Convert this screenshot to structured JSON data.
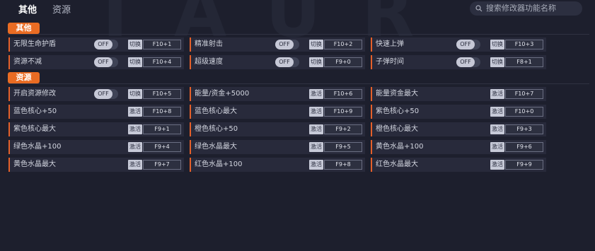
{
  "background_watermark": "TAUR",
  "tabs": [
    {
      "label": "其他",
      "active": true
    },
    {
      "label": "资源",
      "active": false
    }
  ],
  "search": {
    "placeholder": "搜索修改器功能名称"
  },
  "sections": [
    {
      "title": "其他",
      "rows": [
        [
          {
            "label": "无限生命护盾",
            "toggle": "OFF",
            "button": "切换",
            "hotkey": "F10+1"
          },
          {
            "label": "精准射击",
            "toggle": "OFF",
            "button": "切换",
            "hotkey": "F10+2"
          },
          {
            "label": "快速上弹",
            "toggle": "OFF",
            "button": "切换",
            "hotkey": "F10+3"
          }
        ],
        [
          {
            "label": "资源不减",
            "toggle": "OFF",
            "button": "切换",
            "hotkey": "F10+4"
          },
          {
            "label": "超级速度",
            "toggle": "OFF",
            "button": "切换",
            "hotkey": "F9+0"
          },
          {
            "label": "子弹时间",
            "toggle": "OFF",
            "button": "切换",
            "hotkey": "F8+1"
          }
        ]
      ]
    },
    {
      "title": "资源",
      "rows": [
        [
          {
            "label": "开启资源修改",
            "toggle": "OFF",
            "button": "切换",
            "hotkey": "F10+5"
          },
          {
            "label": "能量/资金+5000",
            "button": "激活",
            "hotkey": "F10+6"
          },
          {
            "label": "能量资金最大",
            "button": "激活",
            "hotkey": "F10+7"
          }
        ],
        [
          {
            "label": "蓝色核心+50",
            "button": "激活",
            "hotkey": "F10+8"
          },
          {
            "label": "蓝色核心最大",
            "button": "激活",
            "hotkey": "F10+9"
          },
          {
            "label": "紫色核心+50",
            "button": "激活",
            "hotkey": "F10+0"
          }
        ],
        [
          {
            "label": "紫色核心最大",
            "button": "激活",
            "hotkey": "F9+1"
          },
          {
            "label": "橙色核心+50",
            "button": "激活",
            "hotkey": "F9+2"
          },
          {
            "label": "橙色核心最大",
            "button": "激活",
            "hotkey": "F9+3"
          }
        ],
        [
          {
            "label": "绿色水晶+100",
            "button": "激活",
            "hotkey": "F9+4"
          },
          {
            "label": "绿色水晶最大",
            "button": "激活",
            "hotkey": "F9+5"
          },
          {
            "label": "黄色水晶+100",
            "button": "激活",
            "hotkey": "F9+6"
          }
        ],
        [
          {
            "label": "黄色水晶最大",
            "button": "激活",
            "hotkey": "F9+7"
          },
          {
            "label": "红色水晶+100",
            "button": "激活",
            "hotkey": "F9+8"
          },
          {
            "label": "红色水晶最大",
            "button": "激活",
            "hotkey": "F9+9"
          }
        ]
      ]
    }
  ],
  "colors": {
    "accent": "#ea6c23",
    "background": "#1d1f2d",
    "cell": "#282a3b"
  }
}
